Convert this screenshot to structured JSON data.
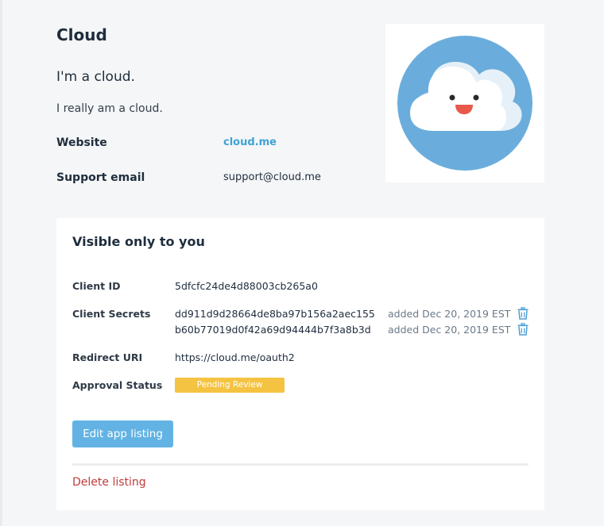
{
  "app": {
    "name": "Cloud",
    "tagline": "I'm a cloud.",
    "description": "I really am a cloud."
  },
  "info": {
    "website_label": "Website",
    "website_value": "cloud.me",
    "support_label": "Support email",
    "support_value": "support@cloud.me"
  },
  "private_section": {
    "title": "Visible only to you",
    "client_id_label": "Client ID",
    "client_id": "5dfcfc24de4d88003cb265a0",
    "client_secrets_label": "Client Secrets",
    "client_secrets": [
      {
        "secret": "dd911d9d28664de8ba97b156a2aec155",
        "added": "added Dec 20, 2019 EST"
      },
      {
        "secret": "b60b77019d0f42a69d94444b7f3a8b3d",
        "added": "added Dec 20, 2019 EST"
      }
    ],
    "redirect_uri_label": "Redirect URI",
    "redirect_uri": "https://cloud.me/oauth2",
    "approval_status_label": "Approval Status",
    "approval_status": "Pending Review",
    "edit_button": "Edit app listing",
    "delete_link": "Delete listing"
  },
  "icons": {
    "logo": "cloud-logo-icon",
    "delete_secret": "trash-icon"
  },
  "colors": {
    "page_background": "#f5f6f7",
    "link": "#3fa2d5",
    "button": "#62b3e4",
    "status_pending": "#f5c342",
    "danger": "#c23b3b",
    "logo_circle": "#6aaddc"
  }
}
